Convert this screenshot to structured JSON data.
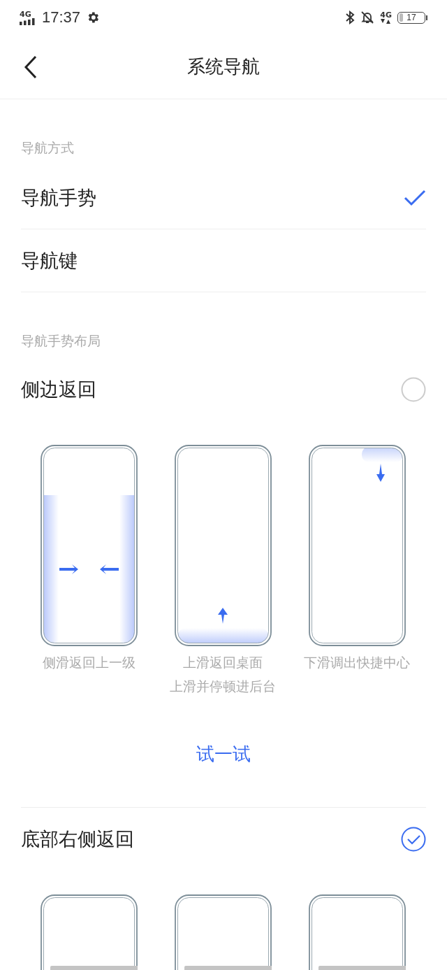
{
  "status_bar": {
    "network": "4G",
    "time": "17:37",
    "data_network": "4G",
    "battery": "17"
  },
  "header": {
    "title": "系统导航"
  },
  "navigation_method": {
    "label": "导航方式",
    "options": [
      {
        "label": "导航手势",
        "selected": true
      },
      {
        "label": "导航键",
        "selected": false
      }
    ]
  },
  "gesture_layout": {
    "label": "导航手势布局",
    "layouts": [
      {
        "label": "侧边返回",
        "selected": false,
        "illustrations": [
          {
            "kind": "side",
            "captions": [
              "侧滑返回上一级"
            ]
          },
          {
            "kind": "up",
            "captions": [
              "上滑返回桌面",
              "上滑并停顿进后台"
            ]
          },
          {
            "kind": "down",
            "captions": [
              "下滑调出快捷中心"
            ]
          }
        ],
        "try_button": "试一试"
      },
      {
        "label": "底部右侧返回",
        "selected": true,
        "illustrations": [
          {
            "kind": "bar"
          },
          {
            "kind": "bar"
          },
          {
            "kind": "bar"
          }
        ]
      }
    ]
  }
}
